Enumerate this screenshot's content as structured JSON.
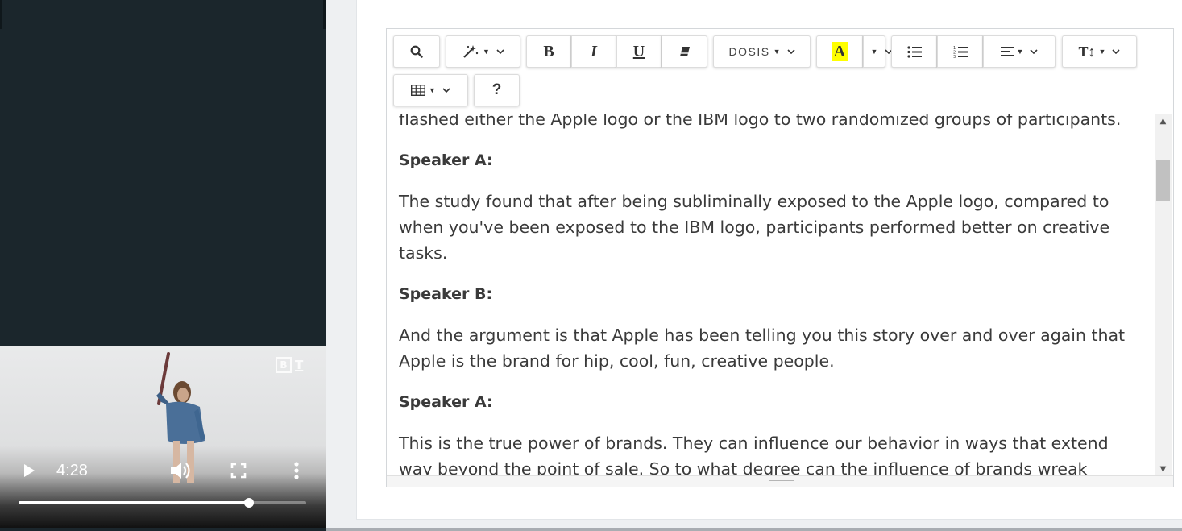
{
  "video": {
    "time": "4:28",
    "progress": 0.8,
    "logo_letters": [
      "B",
      "T"
    ]
  },
  "toolbar": {
    "font_name": "DOSIS",
    "highlight_letter": "A",
    "highlight_color": "#ffff00",
    "help_label": "?",
    "icons": [
      "search-icon",
      "magic-wand-icon",
      "bold-icon",
      "italic-icon",
      "underline-icon",
      "eraser-icon",
      "font-family-dropdown",
      "highlight-icon",
      "more-color-icon",
      "unordered-list-icon",
      "ordered-list-icon",
      "align-icon",
      "text-size-icon",
      "table-icon",
      "help-icon"
    ]
  },
  "editor": {
    "paragraphs": [
      {
        "type": "text",
        "text": "flashed either the Apple logo or the IBM logo to two randomized groups of participants."
      },
      {
        "type": "speaker",
        "text": "Speaker A:"
      },
      {
        "type": "text",
        "text": "The study found that after being subliminally exposed to the Apple logo, compared to when you've been exposed to the IBM logo, participants performed better on creative tasks."
      },
      {
        "type": "speaker",
        "text": "Speaker B:"
      },
      {
        "type": "text",
        "text": "And the argument is that Apple has been telling you this story over and over again that Apple is the brand for hip, cool, fun, creative people."
      },
      {
        "type": "speaker",
        "text": "Speaker A:"
      },
      {
        "type": "text",
        "text": "This is the true power of brands. They can influence our behavior in ways that extend way beyond the point of sale. So to what degree can the influence of brands wreak"
      }
    ]
  }
}
